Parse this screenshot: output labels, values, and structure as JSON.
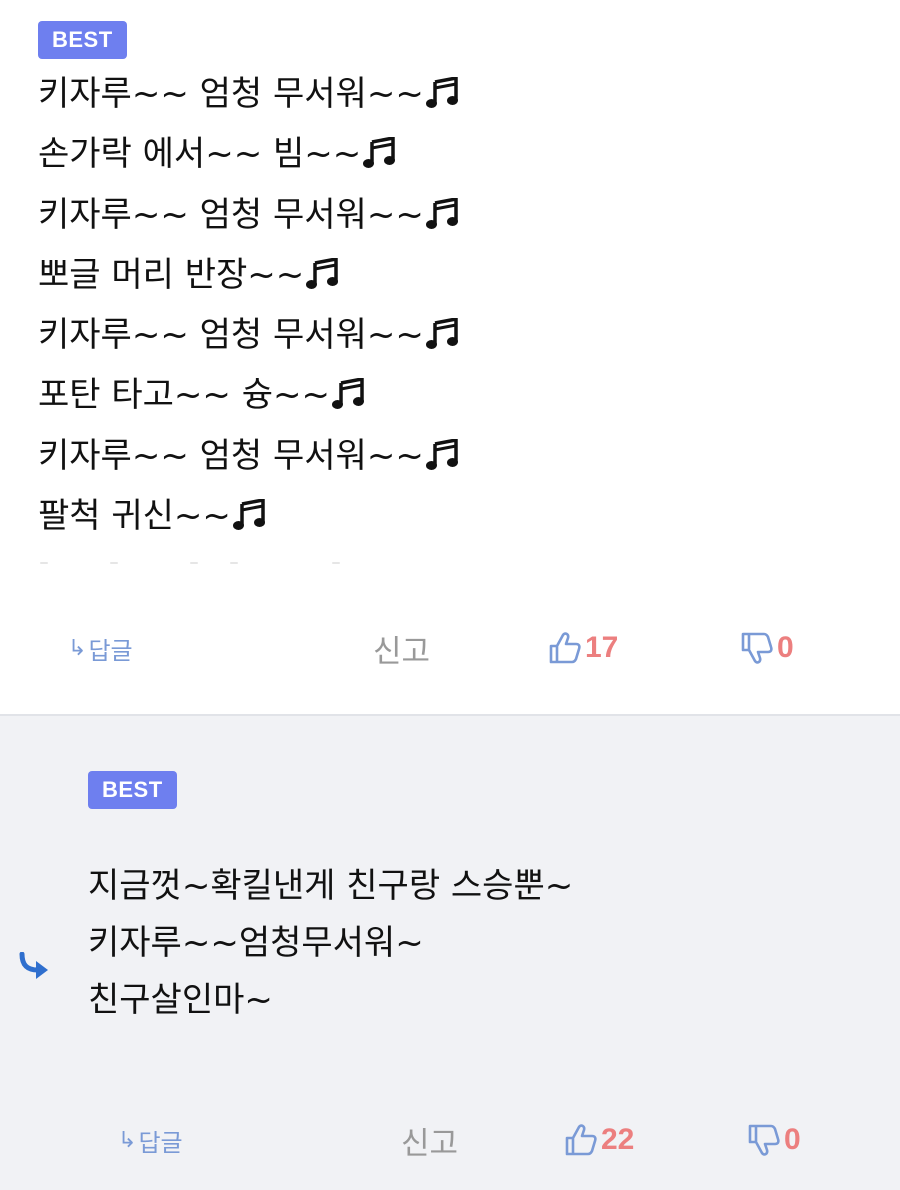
{
  "comments": [
    {
      "badge": "BEST",
      "lines": [
        "키자루~~ 엄청 무서워~~",
        "손가락 에서~~ 빔~~",
        "키자루~~ 엄청 무서워~~",
        "뽀글 머리 반장~~",
        "키자루~~ 엄청 무서워~~",
        "포탄 타고~~ 슝~~",
        "키자루~~ 엄청 무서워~~",
        "팔척 귀신~~"
      ],
      "line_end_icon": "music-note-icon",
      "reply_label": "답글",
      "report_label": "신고",
      "likes": "17",
      "dislikes": "0"
    },
    {
      "badge": "BEST",
      "is_reply": true,
      "lines": [
        "지금껏~확킬낸게 친구랑 스승뿐~",
        "키자루~~엄청무서워~",
        "친구살인마~"
      ],
      "reply_label": "답글",
      "report_label": "신고",
      "likes": "22",
      "dislikes": "0"
    }
  ],
  "colors": {
    "badge": "#6e7fef",
    "count": "#ec7f7f",
    "thumb": "#7a9ad6",
    "reply_arrow": "#2f6fce",
    "reply_bg": "#f1f2f5"
  }
}
